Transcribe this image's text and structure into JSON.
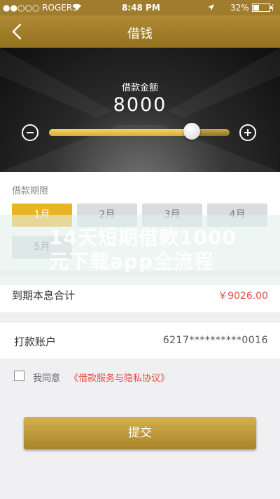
{
  "status_bar": {
    "carrier": "●●○○○ ROGERS",
    "wifi_icon": "wifi-icon",
    "time": "8:48 PM",
    "battery_percent": "32%",
    "location_icon": "location-arrow-icon",
    "battery_icon": "battery-charging-icon"
  },
  "nav": {
    "title": "借钱",
    "back_icon": "chevron-left-icon"
  },
  "loan": {
    "amount_label": "借款金额",
    "amount_value": "8000",
    "slider_level_fraction": 0.79,
    "minus_icon": "minus-circle-icon",
    "plus_icon": "plus-circle-icon"
  },
  "term": {
    "label": "借款期限",
    "options": [
      "1月",
      "2月",
      "3月",
      "4月",
      "5月"
    ],
    "selected_index": 0
  },
  "watermark": {
    "text": "14天短期借款1000元下载app全流程"
  },
  "total": {
    "label": "到期本息合计",
    "value": "￥9026.00"
  },
  "account": {
    "label": "打款账户",
    "value": "6217**********0016"
  },
  "agreement": {
    "prefix": "我同意",
    "link": "《借款服务与隐私协议》"
  },
  "submit": {
    "label": "提交"
  },
  "colors": {
    "gold": "#b08a35",
    "accent_red": "#e14e3e",
    "term_active": "#eab320"
  }
}
